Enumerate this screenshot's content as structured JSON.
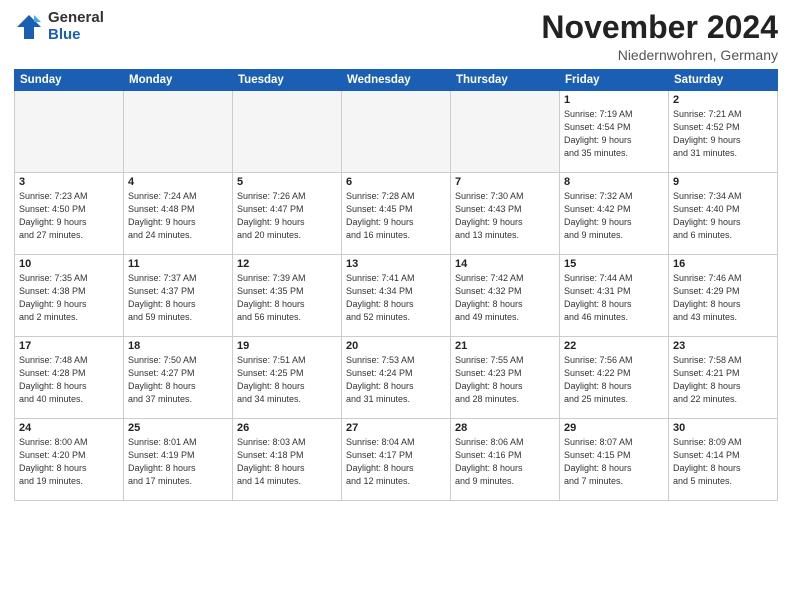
{
  "logo": {
    "general": "General",
    "blue": "Blue"
  },
  "title": "November 2024",
  "location": "Niedernwohren, Germany",
  "weekdays": [
    "Sunday",
    "Monday",
    "Tuesday",
    "Wednesday",
    "Thursday",
    "Friday",
    "Saturday"
  ],
  "weeks": [
    [
      {
        "day": "",
        "info": ""
      },
      {
        "day": "",
        "info": ""
      },
      {
        "day": "",
        "info": ""
      },
      {
        "day": "",
        "info": ""
      },
      {
        "day": "",
        "info": ""
      },
      {
        "day": "1",
        "info": "Sunrise: 7:19 AM\nSunset: 4:54 PM\nDaylight: 9 hours\nand 35 minutes."
      },
      {
        "day": "2",
        "info": "Sunrise: 7:21 AM\nSunset: 4:52 PM\nDaylight: 9 hours\nand 31 minutes."
      }
    ],
    [
      {
        "day": "3",
        "info": "Sunrise: 7:23 AM\nSunset: 4:50 PM\nDaylight: 9 hours\nand 27 minutes."
      },
      {
        "day": "4",
        "info": "Sunrise: 7:24 AM\nSunset: 4:48 PM\nDaylight: 9 hours\nand 24 minutes."
      },
      {
        "day": "5",
        "info": "Sunrise: 7:26 AM\nSunset: 4:47 PM\nDaylight: 9 hours\nand 20 minutes."
      },
      {
        "day": "6",
        "info": "Sunrise: 7:28 AM\nSunset: 4:45 PM\nDaylight: 9 hours\nand 16 minutes."
      },
      {
        "day": "7",
        "info": "Sunrise: 7:30 AM\nSunset: 4:43 PM\nDaylight: 9 hours\nand 13 minutes."
      },
      {
        "day": "8",
        "info": "Sunrise: 7:32 AM\nSunset: 4:42 PM\nDaylight: 9 hours\nand 9 minutes."
      },
      {
        "day": "9",
        "info": "Sunrise: 7:34 AM\nSunset: 4:40 PM\nDaylight: 9 hours\nand 6 minutes."
      }
    ],
    [
      {
        "day": "10",
        "info": "Sunrise: 7:35 AM\nSunset: 4:38 PM\nDaylight: 9 hours\nand 2 minutes."
      },
      {
        "day": "11",
        "info": "Sunrise: 7:37 AM\nSunset: 4:37 PM\nDaylight: 8 hours\nand 59 minutes."
      },
      {
        "day": "12",
        "info": "Sunrise: 7:39 AM\nSunset: 4:35 PM\nDaylight: 8 hours\nand 56 minutes."
      },
      {
        "day": "13",
        "info": "Sunrise: 7:41 AM\nSunset: 4:34 PM\nDaylight: 8 hours\nand 52 minutes."
      },
      {
        "day": "14",
        "info": "Sunrise: 7:42 AM\nSunset: 4:32 PM\nDaylight: 8 hours\nand 49 minutes."
      },
      {
        "day": "15",
        "info": "Sunrise: 7:44 AM\nSunset: 4:31 PM\nDaylight: 8 hours\nand 46 minutes."
      },
      {
        "day": "16",
        "info": "Sunrise: 7:46 AM\nSunset: 4:29 PM\nDaylight: 8 hours\nand 43 minutes."
      }
    ],
    [
      {
        "day": "17",
        "info": "Sunrise: 7:48 AM\nSunset: 4:28 PM\nDaylight: 8 hours\nand 40 minutes."
      },
      {
        "day": "18",
        "info": "Sunrise: 7:50 AM\nSunset: 4:27 PM\nDaylight: 8 hours\nand 37 minutes."
      },
      {
        "day": "19",
        "info": "Sunrise: 7:51 AM\nSunset: 4:25 PM\nDaylight: 8 hours\nand 34 minutes."
      },
      {
        "day": "20",
        "info": "Sunrise: 7:53 AM\nSunset: 4:24 PM\nDaylight: 8 hours\nand 31 minutes."
      },
      {
        "day": "21",
        "info": "Sunrise: 7:55 AM\nSunset: 4:23 PM\nDaylight: 8 hours\nand 28 minutes."
      },
      {
        "day": "22",
        "info": "Sunrise: 7:56 AM\nSunset: 4:22 PM\nDaylight: 8 hours\nand 25 minutes."
      },
      {
        "day": "23",
        "info": "Sunrise: 7:58 AM\nSunset: 4:21 PM\nDaylight: 8 hours\nand 22 minutes."
      }
    ],
    [
      {
        "day": "24",
        "info": "Sunrise: 8:00 AM\nSunset: 4:20 PM\nDaylight: 8 hours\nand 19 minutes."
      },
      {
        "day": "25",
        "info": "Sunrise: 8:01 AM\nSunset: 4:19 PM\nDaylight: 8 hours\nand 17 minutes."
      },
      {
        "day": "26",
        "info": "Sunrise: 8:03 AM\nSunset: 4:18 PM\nDaylight: 8 hours\nand 14 minutes."
      },
      {
        "day": "27",
        "info": "Sunrise: 8:04 AM\nSunset: 4:17 PM\nDaylight: 8 hours\nand 12 minutes."
      },
      {
        "day": "28",
        "info": "Sunrise: 8:06 AM\nSunset: 4:16 PM\nDaylight: 8 hours\nand 9 minutes."
      },
      {
        "day": "29",
        "info": "Sunrise: 8:07 AM\nSunset: 4:15 PM\nDaylight: 8 hours\nand 7 minutes."
      },
      {
        "day": "30",
        "info": "Sunrise: 8:09 AM\nSunset: 4:14 PM\nDaylight: 8 hours\nand 5 minutes."
      }
    ]
  ]
}
